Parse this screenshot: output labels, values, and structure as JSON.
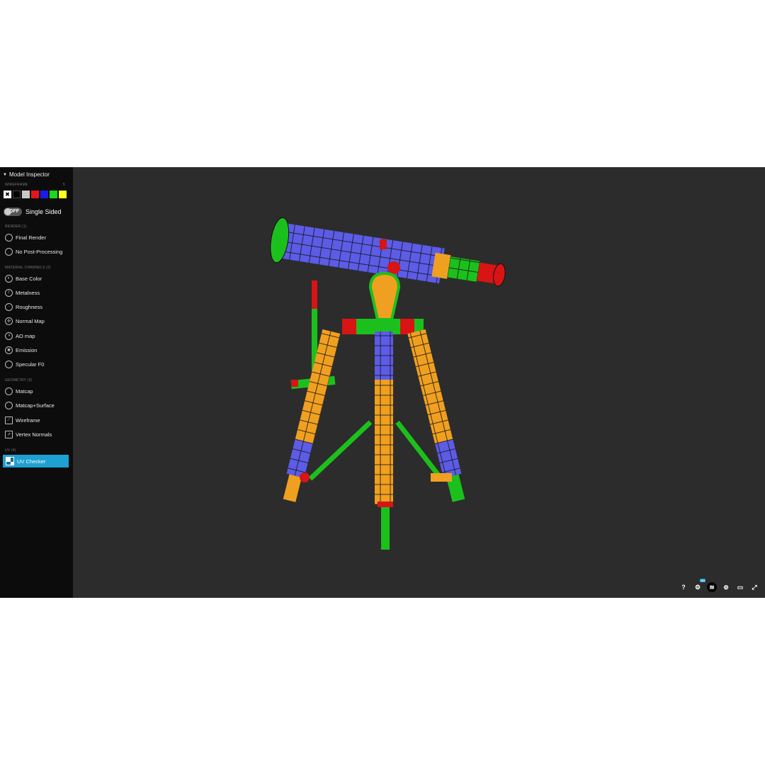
{
  "sidebar": {
    "title": "Model Inspector",
    "wireframe_label": "WIREFRAME",
    "wireframe_value": "5",
    "swatches": [
      "#ffffff",
      "#000000",
      "#c8c8c8",
      "#e8141c",
      "#1c1ce8",
      "#1cd81c",
      "#ffff1c"
    ],
    "toggle_label": "OFF",
    "single_sided": "Single Sided",
    "render_label": "RENDER (1)",
    "render_items": [
      "Final Render",
      "No Post-Processing"
    ],
    "material_label": "MATERIAL CHANNELS (2)",
    "material_items": [
      "Base Color",
      "Metalness",
      "Roughness",
      "Normal Map",
      "AO map",
      "Emission",
      "Specular F0"
    ],
    "geometry_label": "GEOMETRY (3)",
    "geometry_items": [
      "Matcap",
      "Matcap+Surface",
      "Wireframe",
      "Vertex Normals"
    ],
    "uv_label": "UV (4)",
    "uv_items": [
      "UV Checker"
    ]
  },
  "toolbar": {
    "help": "?",
    "settings_badge": "HD",
    "icons": [
      "help-icon",
      "settings-icon",
      "layers-icon",
      "vr-icon",
      "screenshot-icon",
      "fullscreen-icon"
    ]
  },
  "colors": {
    "accent": "#1ea0d2",
    "blue": "#5c5ce6",
    "orange": "#f0a020",
    "green": "#1cc01c",
    "red": "#d81414"
  }
}
